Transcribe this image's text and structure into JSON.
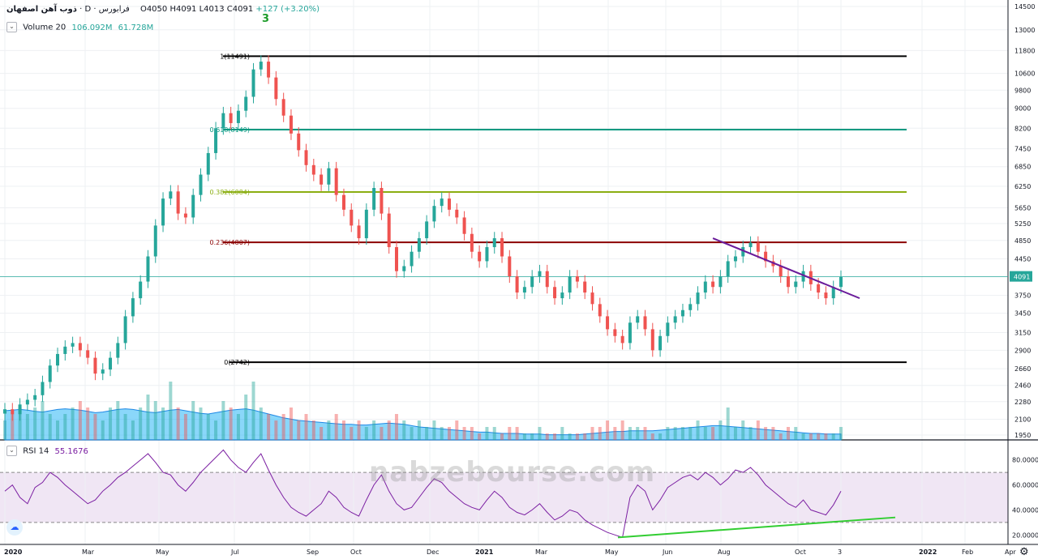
{
  "header": {
    "symbol": "ذوب آهن اصفهان",
    "timeframe": "D",
    "exchange": "فرابورس",
    "ohlc": "O4050 H4091 L4013 C4091",
    "change": "+127 (+3.20%)"
  },
  "volume_indicator": {
    "label": "Volume 20",
    "value1": "106.092M",
    "value2": "61.728M"
  },
  "rsi_indicator": {
    "label": "RSI 14",
    "value": "55.1676"
  },
  "wave_label": "3",
  "watermark": "nabzebourse.com",
  "colors": {
    "up": "#26a69a",
    "down": "#ef5350",
    "rsi": "#7b1fa2",
    "fib1": "#000000",
    "fib618": "#089981",
    "fib382": "#8bae12",
    "fib236": "#8b0000",
    "trend_down": "#6a1b9a",
    "trend_up": "#32cd32"
  },
  "chart_data": {
    "type": "candlestick",
    "price_axis": {
      "ticks": [
        14500,
        13000,
        11800,
        10600,
        9800,
        9000,
        8200,
        7450,
        6850,
        6250,
        5650,
        5250,
        4850,
        4450,
        4091,
        3750,
        3450,
        3150,
        2900,
        2660,
        2460,
        2280,
        2100,
        1950
      ],
      "current_price": "4091",
      "scale": "log"
    },
    "time_axis": {
      "labels": [
        "2020",
        "Mar",
        "May",
        "Jul",
        "Sep",
        "Oct",
        "Dec",
        "2021",
        "Mar",
        "May",
        "Jun",
        "Aug",
        "Oct",
        "3",
        "2022",
        "Feb",
        "Apr"
      ]
    },
    "fib_levels": [
      {
        "label": "1(11491)",
        "value": 11491
      },
      {
        "label": "0.618(8149)",
        "value": 8149
      },
      {
        "label": "0.382(6084)",
        "value": 6084
      },
      {
        "label": "0.236(4807)",
        "value": 4807
      },
      {
        "label": "0(2742)",
        "value": 2742
      }
    ],
    "price_closes": [
      2200,
      2150,
      2250,
      2300,
      2350,
      2500,
      2700,
      2850,
      2950,
      3000,
      2900,
      2800,
      2600,
      2650,
      2800,
      3000,
      3400,
      3700,
      4000,
      4500,
      5200,
      5900,
      6100,
      5500,
      5400,
      6000,
      6600,
      7300,
      8200,
      8800,
      8400,
      8900,
      9500,
      10800,
      11200,
      10400,
      9400,
      8700,
      8000,
      7400,
      6900,
      6600,
      6300,
      6800,
      6000,
      5600,
      5200,
      4900,
      5600,
      6200,
      5500,
      4700,
      4200,
      4300,
      4600,
      4900,
      5300,
      5700,
      5900,
      5600,
      5400,
      5000,
      4600,
      4400,
      4700,
      4900,
      4500,
      4100,
      3800,
      3900,
      4100,
      4200,
      3900,
      3700,
      3800,
      4100,
      4000,
      3800,
      3600,
      3400,
      3200,
      3100,
      3000,
      3300,
      3400,
      3200,
      2900,
      3100,
      3300,
      3400,
      3500,
      3600,
      3800,
      4000,
      3900,
      4100,
      4400,
      4500,
      4700,
      4800,
      4600,
      4400,
      4300,
      4100,
      3900,
      4000,
      4200,
      3950,
      3800,
      3700,
      3900,
      4091
    ],
    "volume": [
      0.3,
      0.4,
      0.5,
      0.4,
      0.5,
      0.6,
      0.4,
      0.3,
      0.4,
      0.5,
      0.6,
      0.5,
      0.4,
      0.3,
      0.5,
      0.6,
      0.4,
      0.3,
      0.5,
      0.7,
      0.6,
      0.5,
      0.9,
      0.5,
      0.4,
      0.6,
      0.5,
      0.4,
      0.3,
      0.6,
      0.5,
      0.4,
      0.7,
      0.9,
      0.5,
      0.4,
      0.3,
      0.4,
      0.5,
      0.3,
      0.4,
      0.3,
      0.2,
      0.3,
      0.4,
      0.3,
      0.2,
      0.3,
      0.2,
      0.3,
      0.2,
      0.3,
      0.4,
      0.3,
      0.2,
      0.3,
      0.2,
      0.3,
      0.2,
      0.2,
      0.3,
      0.2,
      0.2,
      0.1,
      0.2,
      0.2,
      0.1,
      0.2,
      0.2,
      0.1,
      0.1,
      0.2,
      0.1,
      0.1,
      0.2,
      0.1,
      0.1,
      0.1,
      0.2,
      0.2,
      0.3,
      0.2,
      0.3,
      0.2,
      0.2,
      0.2,
      0.1,
      0.1,
      0.2,
      0.2,
      0.2,
      0.2,
      0.3,
      0.2,
      0.2,
      0.3,
      0.5,
      0.2,
      0.3,
      0.2,
      0.3,
      0.2,
      0.2,
      0.1,
      0.2,
      0.2,
      0.1,
      0.1,
      0.1,
      0.1,
      0.1,
      0.2
    ],
    "volume_ma": [
      0.45,
      0.46,
      0.47,
      0.46,
      0.44,
      0.43,
      0.45,
      0.47,
      0.48,
      0.47,
      0.46,
      0.44,
      0.42,
      0.43,
      0.45,
      0.47,
      0.48,
      0.47,
      0.45,
      0.43,
      0.42,
      0.44,
      0.46,
      0.47,
      0.45,
      0.43,
      0.41,
      0.4,
      0.42,
      0.44,
      0.46,
      0.47,
      0.48,
      0.46,
      0.43,
      0.4,
      0.37,
      0.34,
      0.32,
      0.3,
      0.29,
      0.28,
      0.27,
      0.26,
      0.25,
      0.24,
      0.24,
      0.23,
      0.23,
      0.24,
      0.25,
      0.26,
      0.25,
      0.24,
      0.22,
      0.2,
      0.19,
      0.18,
      0.17,
      0.16,
      0.15,
      0.14,
      0.13,
      0.12,
      0.12,
      0.11,
      0.1,
      0.1,
      0.1,
      0.09,
      0.09,
      0.09,
      0.08,
      0.08,
      0.08,
      0.08,
      0.08,
      0.09,
      0.1,
      0.11,
      0.12,
      0.13,
      0.13,
      0.14,
      0.14,
      0.14,
      0.14,
      0.15,
      0.16,
      0.17,
      0.18,
      0.19,
      0.2,
      0.21,
      0.22,
      0.22,
      0.21,
      0.2,
      0.19,
      0.18,
      0.17,
      0.16,
      0.15,
      0.14,
      0.13,
      0.12,
      0.11,
      0.1,
      0.1,
      0.09,
      0.09,
      0.09
    ],
    "rsi_axis": {
      "ticks": [
        80,
        60,
        40,
        20
      ],
      "labels": [
        "80.0000",
        "60.0000",
        "40.0000",
        "20.0000"
      ],
      "upper_band": 70,
      "lower_band": 30
    },
    "rsi": [
      55,
      60,
      50,
      45,
      58,
      62,
      70,
      66,
      60,
      55,
      50,
      45,
      48,
      55,
      60,
      66,
      70,
      75,
      80,
      85,
      78,
      70,
      68,
      60,
      55,
      62,
      70,
      76,
      82,
      88,
      80,
      74,
      70,
      78,
      85,
      72,
      60,
      50,
      42,
      38,
      35,
      40,
      45,
      55,
      50,
      42,
      38,
      35,
      48,
      60,
      68,
      55,
      45,
      40,
      42,
      50,
      58,
      65,
      62,
      55,
      50,
      45,
      42,
      40,
      48,
      55,
      50,
      42,
      38,
      36,
      40,
      45,
      38,
      32,
      35,
      40,
      38,
      32,
      28,
      25,
      22,
      20,
      18,
      50,
      60,
      55,
      40,
      48,
      58,
      62,
      66,
      68,
      64,
      70,
      66,
      60,
      65,
      72,
      70,
      74,
      68,
      60,
      55,
      50,
      45,
      42,
      48,
      40,
      38,
      36,
      44,
      55
    ]
  }
}
